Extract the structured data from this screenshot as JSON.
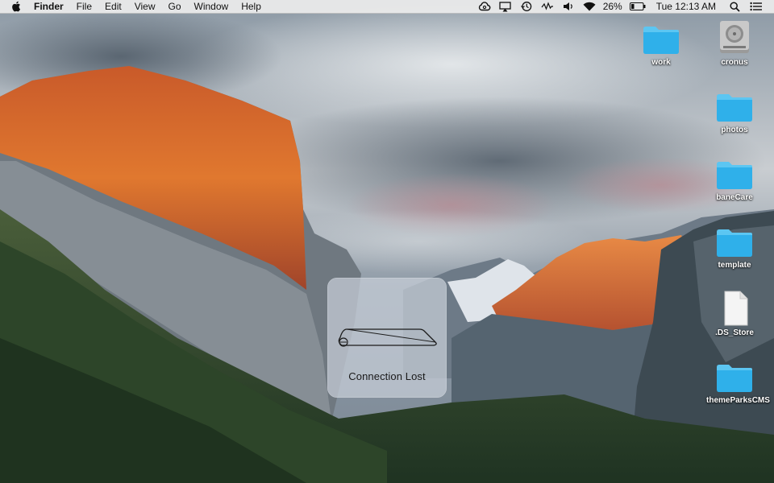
{
  "menubar": {
    "apple_icon": "apple-logo-icon",
    "items": [
      "Finder",
      "File",
      "Edit",
      "View",
      "Go",
      "Window",
      "Help"
    ],
    "status": {
      "icons": [
        "creative-cloud-icon",
        "airplay-icon",
        "time-machine-icon",
        "activity-icon",
        "volume-icon",
        "wifi-icon"
      ],
      "battery_percent": "26%",
      "battery_level": 0.26,
      "clock": "Tue 12:13 AM",
      "extra_icons": [
        "search-icon",
        "notification-center-icon"
      ]
    }
  },
  "desktop": {
    "icons": [
      {
        "label": "work",
        "kind": "folder"
      },
      {
        "label": "cronus",
        "kind": "hard-drive"
      },
      {
        "label": "photos",
        "kind": "folder"
      },
      {
        "label": "baneCare",
        "kind": "folder"
      },
      {
        "label": "template",
        "kind": "folder"
      },
      {
        "label": ".DS_Store",
        "kind": "file"
      },
      {
        "label": "themeParksCMS",
        "kind": "folder"
      }
    ]
  },
  "hud": {
    "icon": "trackpad-icon",
    "message": "Connection Lost"
  },
  "colors": {
    "folder": "#2fb0ea",
    "folder_tab": "#5cc6f2",
    "menubar": "#ececec"
  }
}
